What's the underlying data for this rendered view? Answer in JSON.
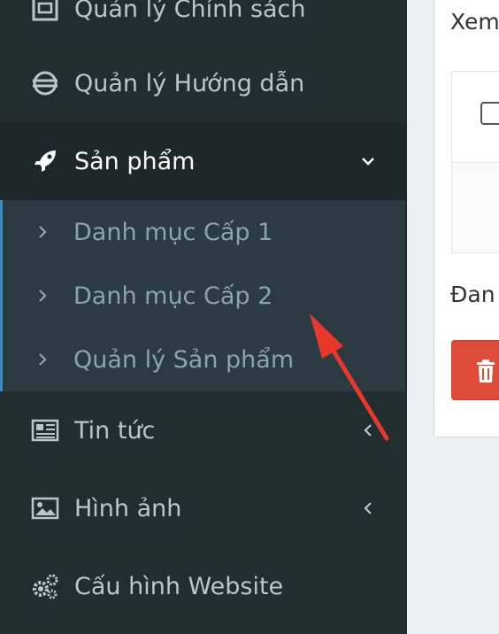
{
  "sidebar": {
    "items": [
      {
        "label": "Quản lý Chính sách",
        "icon": "building-icon"
      },
      {
        "label": "Quản lý Hướng dẫn",
        "icon": "globe-icon"
      },
      {
        "label": "Sản phẩm",
        "icon": "rocket-icon",
        "expanded": true
      },
      {
        "label": "Tin tức",
        "icon": "newspaper-icon"
      },
      {
        "label": "Hình ảnh",
        "icon": "image-icon"
      },
      {
        "label": "Cấu hình Website",
        "icon": "gears-icon"
      }
    ],
    "submenu": [
      {
        "label": "Danh mục Cấp 1"
      },
      {
        "label": "Danh mục Cấp 2"
      },
      {
        "label": "Quản lý Sản phẩm"
      }
    ]
  },
  "main": {
    "view_label": "Xem",
    "selected_label": "Đan"
  },
  "colors": {
    "sidebar_bg": "#222d32",
    "submenu_bg": "#2c3b41",
    "danger": "#dd4b39",
    "annotation_arrow": "#e8382a"
  }
}
